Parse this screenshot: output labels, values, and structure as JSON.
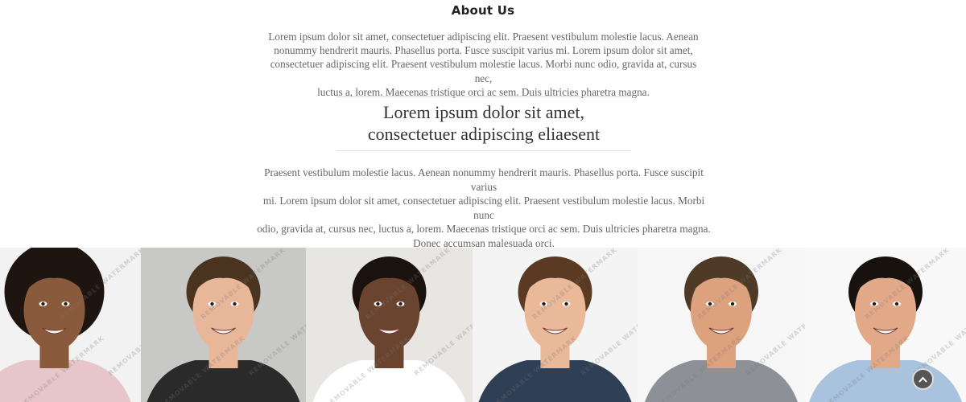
{
  "about": {
    "heading": "About Us",
    "intro_lines": [
      "Lorem ipsum dolor sit amet, consectetuer adipiscing elit. Praesent vestibulum molestie lacus. Aenean",
      "nonummy hendrerit mauris. Phasellus porta. Fusce suscipit varius mi. Lorem ipsum dolor sit amet,",
      "consectetuer adipiscing elit. Praesent vestibulum molestie lacus. Morbi nunc odio, gravida at, cursus nec,",
      "luctus a, lorem. Maecenas tristique orci ac sem. Duis ultricies pharetra magna."
    ],
    "quote_lines": [
      "Lorem ipsum dolor sit amet,",
      "consectetuer adipiscing eliaesent"
    ],
    "body_lines": [
      "Praesent vestibulum molestie lacus. Aenean nonummy hendrerit mauris. Phasellus porta. Fusce suscipit varius",
      "mi. Lorem ipsum dolor sit amet, consectetuer adipiscing elit. Praesent vestibulum molestie lacus. Morbi nunc",
      "odio, gravida at, cursus nec, luctus a, lorem. Maecenas tristique orci ac sem. Duis ultricies pharetra magna.",
      "Donec accumsan malesuada orci."
    ]
  },
  "team": {
    "watermark": "REMOVABLE WATERMARK",
    "photos": [
      {
        "name": "team-photo-1",
        "background": "#f2f2f2",
        "skin": "#8a5a3c",
        "hair": "#1e1410",
        "shirt": "#e7c6c9"
      },
      {
        "name": "team-photo-2",
        "background": "#c8c9c6",
        "skin": "#e8b79a",
        "hair": "#4a3420",
        "shirt": "#2a2a2a"
      },
      {
        "name": "team-photo-3",
        "background": "#e8e6e2",
        "skin": "#6b4430",
        "hair": "#1a120e",
        "shirt": "#ffffff"
      },
      {
        "name": "team-photo-4",
        "background": "#f4f4f4",
        "skin": "#e9b99a",
        "hair": "#5a3a22",
        "shirt": "#2f3f55"
      },
      {
        "name": "team-photo-5",
        "background": "#f6f6f6",
        "skin": "#dba27d",
        "hair": "#4e3a26",
        "shirt": "#8d9096"
      },
      {
        "name": "team-photo-6",
        "background": "#f8f8f8",
        "skin": "#e2a988",
        "hair": "#17120e",
        "shirt": "#a9c3de"
      }
    ]
  },
  "scroll_top": {
    "icon": "chevron-up-icon",
    "color": "#555555"
  }
}
